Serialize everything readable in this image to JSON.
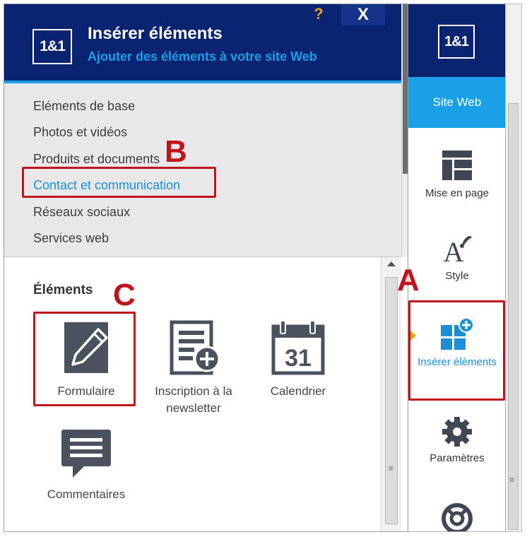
{
  "panel": {
    "logo": "1&1",
    "title": "Insérer éléments",
    "subtitle": "Ajouter des éléments à votre site Web",
    "help_label": "?",
    "close_label": "X",
    "categories": [
      {
        "label": "Eléments de base"
      },
      {
        "label": "Photos et vidéos"
      },
      {
        "label": "Produits et documents"
      },
      {
        "label": "Contact et communication"
      },
      {
        "label": "Réseaux sociaux"
      },
      {
        "label": "Services web"
      }
    ],
    "elements_title": "Éléments",
    "elements": [
      {
        "label": "Formulaire",
        "icon": "pencil-form-icon"
      },
      {
        "label": "Inscription à la newsletter",
        "icon": "newsletter-add-icon"
      },
      {
        "label": "Calendrier",
        "icon": "calendar-icon",
        "day": "31"
      },
      {
        "label": "Commentaires",
        "icon": "comment-icon"
      }
    ]
  },
  "sidebar": {
    "logo": "1&1",
    "site_web": "Site Web",
    "items": [
      {
        "label": "Mise en page",
        "icon": "layout-icon"
      },
      {
        "label": "Style",
        "icon": "style-icon"
      },
      {
        "label": "Insérer éléments",
        "icon": "insert-elements-icon",
        "active": true
      },
      {
        "label": "Paramètres",
        "icon": "gear-icon"
      },
      {
        "label": "",
        "icon": "help-lifebuoy-icon"
      }
    ]
  },
  "annotations": {
    "a": "A",
    "b": "B",
    "c": "C"
  },
  "colors": {
    "header_bg": "#0b2471",
    "accent_blue": "#1aa0e6",
    "annotation_red": "#c0141c",
    "marker_yellow": "#e4a40a"
  }
}
